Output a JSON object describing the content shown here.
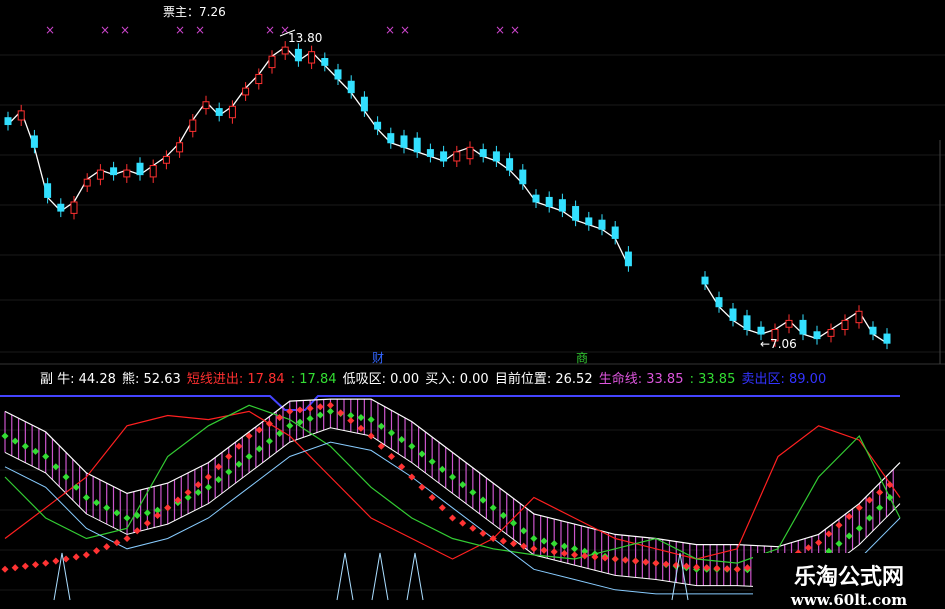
{
  "title": "票主：7.26",
  "markers": {
    "top_x_text": "×",
    "high_label": "13.80",
    "low_label": "7.06",
    "tag_cai": "财",
    "tag_shang": "商"
  },
  "info": [
    {
      "text": "副 牛: 44.28",
      "color": "#ffffff"
    },
    {
      "text": "熊: 52.63",
      "color": "#ffffff"
    },
    {
      "text": "短线进出: 17.84",
      "color": "#ff3030"
    },
    {
      "text": ": 17.84",
      "color": "#33dd33"
    },
    {
      "text": "低吸区: 0.00",
      "color": "#ffffff"
    },
    {
      "text": "买入: 0.00",
      "color": "#ffffff"
    },
    {
      "text": "目前位置: 26.52",
      "color": "#ffffff"
    },
    {
      "text": "生命线: 33.85",
      "color": "#dd55dd"
    },
    {
      "text": ": 33.85",
      "color": "#33dd33"
    },
    {
      "text": "卖出区: 89.00",
      "color": "#3333ff"
    }
  ],
  "watermark": {
    "line1": "乐淘公式网",
    "line2": "www.60lt.com"
  },
  "colors": {
    "up": "#ff3030",
    "down": "#33e0ff",
    "ma": "#ffffff",
    "bear": "#ff2020",
    "bull": "#33cc33",
    "hist": "#cc55cc",
    "band": "#4444ff"
  },
  "chart_data": {
    "type": "line",
    "price_panel": {
      "high": 13.8,
      "low": 7.06,
      "close_path": [
        11.9,
        12.2,
        11.4,
        10.3,
        10.0,
        10.2,
        10.7,
        10.9,
        10.8,
        10.9,
        10.8,
        11.0,
        11.2,
        11.5,
        12.0,
        12.4,
        12.1,
        12.3,
        12.7,
        13.0,
        13.4,
        13.6,
        13.3,
        13.5,
        13.2,
        12.9,
        12.6,
        12.2,
        11.8,
        11.5,
        11.4,
        11.3,
        11.2,
        11.1,
        11.3,
        11.4,
        11.2,
        11.1,
        10.9,
        10.6,
        10.2,
        10.1,
        10.0,
        9.8,
        9.7,
        9.6,
        9.4,
        8.8,
        8.4,
        7.9,
        7.6,
        7.4,
        7.3,
        7.4,
        7.6,
        7.3,
        7.2,
        7.4,
        7.6,
        7.8,
        7.3,
        7.1
      ]
    },
    "indicator_panel": {
      "bull": 44.28,
      "bear": 52.63,
      "short_in_out": 17.84,
      "low_buy_zone": 0.0,
      "buy": 0.0,
      "current_position": 26.52,
      "life_line": 33.85,
      "sell_zone": 89.0,
      "series_red": [
        30,
        45,
        60,
        85,
        90,
        88,
        92,
        80,
        60,
        40,
        30,
        20,
        30,
        50,
        40,
        30,
        25,
        20,
        25,
        70,
        85,
        78,
        50
      ],
      "series_green": [
        60,
        40,
        30,
        35,
        70,
        85,
        95,
        88,
        75,
        55,
        40,
        30,
        25,
        22,
        20,
        25,
        30,
        20,
        18,
        25,
        60,
        80,
        40
      ],
      "series_dots_green": [
        80,
        70,
        50,
        40,
        45,
        55,
        70,
        85,
        92,
        88,
        75,
        60,
        45,
        30,
        25,
        20,
        18,
        15,
        15,
        14,
        20,
        35,
        55
      ],
      "series_dots_red": [
        15,
        18,
        22,
        30,
        45,
        60,
        80,
        92,
        95,
        80,
        60,
        40,
        30,
        25,
        22,
        20,
        18,
        16,
        15,
        18,
        28,
        45,
        60
      ]
    }
  }
}
